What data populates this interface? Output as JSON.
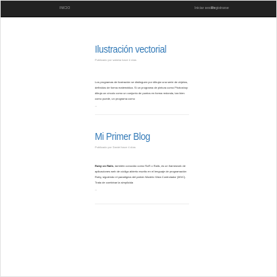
{
  "navbar": {
    "brand": "INICIO",
    "login_label": "Iniciar sesión",
    "register_label": "Registrarse"
  },
  "posts": [
    {
      "title": "Ilustración vectorial",
      "meta": "Publicado por walsha hace 4 días",
      "excerpt": "Los programas de ilustración se distinguen por dibujar una serie de objetos, definidos de forma matemática. Si un programa de pintura como Photoshop dibuja un círculo como un conjunto de puntos en forma redonda, tan bien como puede, un programa como",
      "read_more": "..."
    },
    {
      "title": "Mi Primer Blog",
      "meta": "Publicado por Daniel hace 4 días",
      "excerpt_bold": "Ruby on Rails",
      "excerpt_rest": ", también conocido como RoR o Rails, es un framework de aplicaciones web de código abierto escrito en el lenguaje de programación Ruby, siguiendo el paradigma del patrón Modelo Vista Controlador (MVC). Trata de combinar la simplicida",
      "read_more": "..."
    }
  ]
}
